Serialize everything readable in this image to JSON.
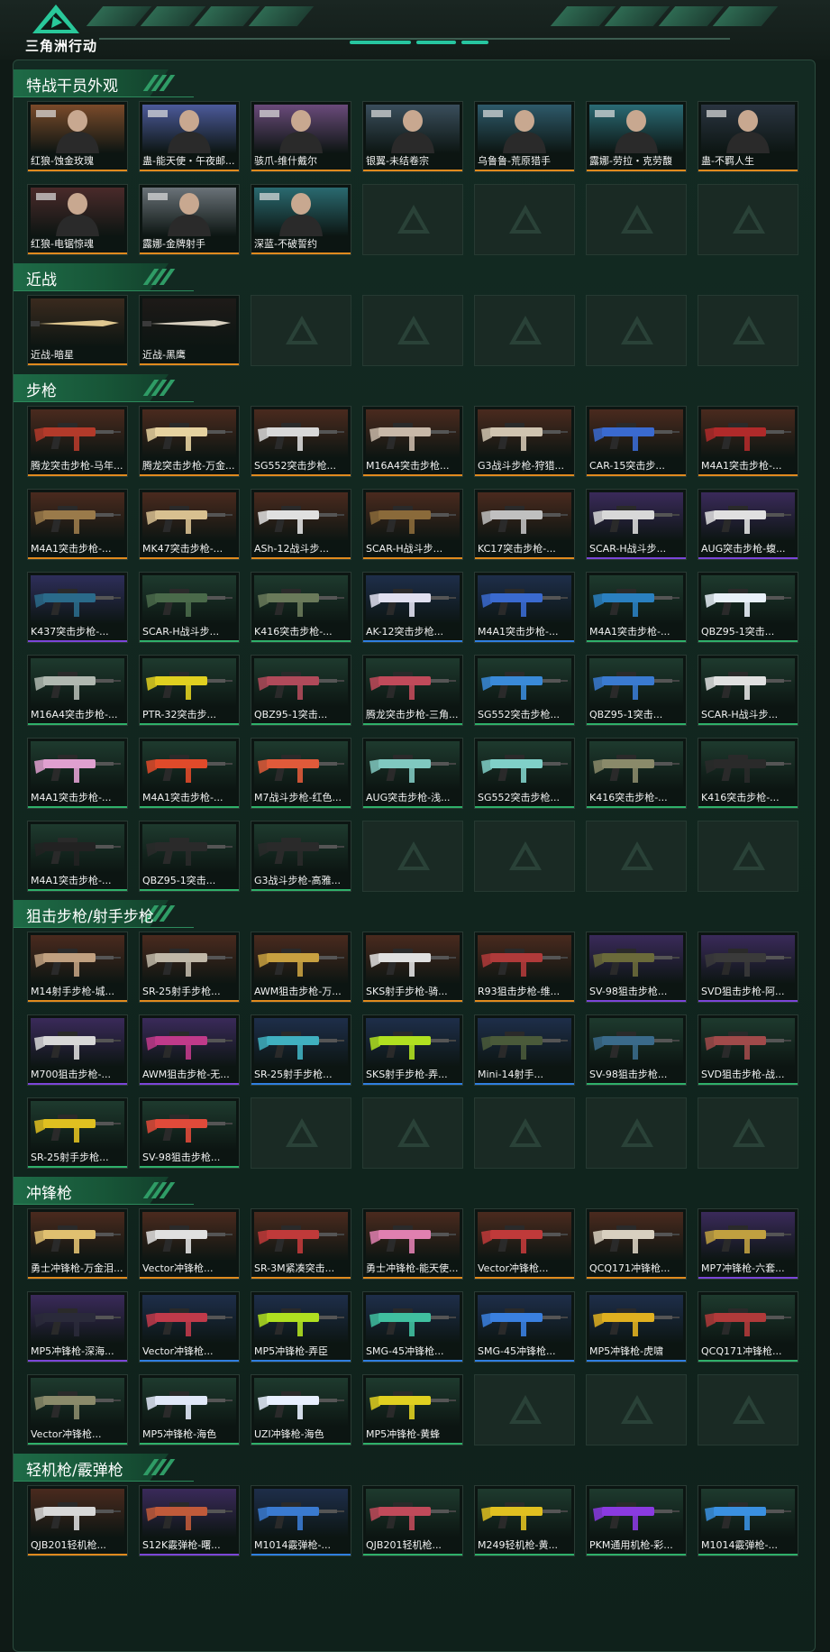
{
  "app": {
    "brand": "三角洲行动",
    "logo_icon": "delta-logo-icon"
  },
  "rarity_colors": {
    "gold": "#e08a1e",
    "purple": "#7b46d8",
    "blue": "#2f7fe0",
    "green": "#2fb06a"
  },
  "sections": [
    {
      "title": "特战干员外观",
      "rows": 2,
      "items": [
        {
          "label": "红狼-蚀金玫瑰",
          "rarity": "gold",
          "kind": "operator",
          "bg": "#7a4a2a"
        },
        {
          "label": "蛊-能天使・午夜邮...",
          "rarity": "gold",
          "kind": "operator",
          "bg": "#4c5a9a"
        },
        {
          "label": "骇爪-维什戴尔",
          "rarity": "gold",
          "kind": "operator",
          "bg": "#6a4a7a"
        },
        {
          "label": "银翼-未结卷宗",
          "rarity": "gold",
          "kind": "operator",
          "bg": "#3a4e5c"
        },
        {
          "label": "乌鲁鲁-荒原猎手",
          "rarity": "gold",
          "kind": "operator",
          "bg": "#2e5a6a"
        },
        {
          "label": "露娜-劳拉・克劳馥",
          "rarity": "gold",
          "kind": "operator",
          "bg": "#2a6a74"
        },
        {
          "label": "蛊-不羁人生",
          "rarity": "gold",
          "kind": "operator",
          "bg": "#2a3440"
        },
        {
          "label": "红狼-电锯惊魂",
          "rarity": "gold",
          "kind": "operator",
          "bg": "#4a2a2a"
        },
        {
          "label": "露娜-金牌射手",
          "rarity": "gold",
          "kind": "operator",
          "bg": "#6a7278"
        },
        {
          "label": "深蓝-不破誓约",
          "rarity": "gold",
          "kind": "operator",
          "bg": "#2a6a70"
        }
      ]
    },
    {
      "title": "近战",
      "rows": 1,
      "items": [
        {
          "label": "近战-暗星",
          "rarity": "gold",
          "kind": "blade",
          "bg": "#3a2a1e",
          "tone": "#e0c890"
        },
        {
          "label": "近战-黑鹰",
          "rarity": "gold",
          "kind": "blade",
          "bg": "#1e1a18",
          "tone": "#d8d0c0"
        }
      ]
    },
    {
      "title": "步枪",
      "rows": 6,
      "items": [
        {
          "label": "腾龙突击步枪-马年...",
          "rarity": "gold",
          "kind": "gun",
          "bg": "#4a2a1e",
          "tone": "#b33a2a"
        },
        {
          "label": "腾龙突击步枪-万金...",
          "rarity": "gold",
          "kind": "gun",
          "bg": "#4a2a1e",
          "tone": "#e6d2a0"
        },
        {
          "label": "SG552突击步枪...",
          "rarity": "gold",
          "kind": "gun",
          "bg": "#4a2a1e",
          "tone": "#d8d8d8"
        },
        {
          "label": "M16A4突击步枪...",
          "rarity": "gold",
          "kind": "gun",
          "bg": "#4a2a1e",
          "tone": "#c8b8a8"
        },
        {
          "label": "G3战斗步枪-狩猎...",
          "rarity": "gold",
          "kind": "gun",
          "bg": "#4a2a1e",
          "tone": "#d0c4b0"
        },
        {
          "label": "CAR-15突击步...",
          "rarity": "gold",
          "kind": "gun",
          "bg": "#4a2a1e",
          "tone": "#3a6ad0"
        },
        {
          "label": "M4A1突击步枪-...",
          "rarity": "gold",
          "kind": "gun",
          "bg": "#4a2a1e",
          "tone": "#b02a2a"
        },
        {
          "label": "M4A1突击步枪-...",
          "rarity": "gold",
          "kind": "gun",
          "bg": "#4a2a1e",
          "tone": "#9a7a4a"
        },
        {
          "label": "MK47突击步枪-...",
          "rarity": "gold",
          "kind": "gun",
          "bg": "#4a2a1e",
          "tone": "#d8c090"
        },
        {
          "label": "ASh-12战斗步...",
          "rarity": "gold",
          "kind": "gun",
          "bg": "#4a2a1e",
          "tone": "#e0e0e0"
        },
        {
          "label": "SCAR-H战斗步...",
          "rarity": "gold",
          "kind": "gun",
          "bg": "#4a2a1e",
          "tone": "#8a6a3a"
        },
        {
          "label": "KC17突击步枪-...",
          "rarity": "gold",
          "kind": "gun",
          "bg": "#4a2a1e",
          "tone": "#c0c0c0"
        },
        {
          "label": "SCAR-H战斗步...",
          "rarity": "purple",
          "kind": "gun",
          "bg": "#3a2a5a",
          "tone": "#d8d8d8"
        },
        {
          "label": "AUG突击步枪-蝮...",
          "rarity": "purple",
          "kind": "gun",
          "bg": "#3a2a5a",
          "tone": "#e0e0e0"
        },
        {
          "label": "K437突击步枪-...",
          "rarity": "purple",
          "kind": "gun",
          "bg": "#2e2e5a",
          "tone": "#2a6a8a"
        },
        {
          "label": "SCAR-H战斗步...",
          "rarity": "green",
          "kind": "gun",
          "bg": "#1e3a2e",
          "tone": "#4a6a4a"
        },
        {
          "label": "K416突击步枪-...",
          "rarity": "green",
          "kind": "gun",
          "bg": "#1e3a2e",
          "tone": "#6a7a5a"
        },
        {
          "label": "AK-12突击步枪...",
          "rarity": "blue",
          "kind": "gun",
          "bg": "#1e2e4a",
          "tone": "#e0e0f0"
        },
        {
          "label": "M4A1突击步枪-...",
          "rarity": "blue",
          "kind": "gun",
          "bg": "#1e2e4a",
          "tone": "#3a6ad0"
        },
        {
          "label": "M4A1突击步枪-...",
          "rarity": "green",
          "kind": "gun",
          "bg": "#1e3a2e",
          "tone": "#2a80c0"
        },
        {
          "label": "QBZ95-1突击...",
          "rarity": "green",
          "kind": "gun",
          "bg": "#1e3a2e",
          "tone": "#e8f0f8"
        },
        {
          "label": "M16A4突击步枪-...",
          "rarity": "green",
          "kind": "gun",
          "bg": "#1e3a2e",
          "tone": "#b0b8b0"
        },
        {
          "label": "PTR-32突击步...",
          "rarity": "green",
          "kind": "gun",
          "bg": "#1e3a2e",
          "tone": "#e0d020"
        },
        {
          "label": "QBZ95-1突击...",
          "rarity": "green",
          "kind": "gun",
          "bg": "#1e3a2e",
          "tone": "#b04a5a"
        },
        {
          "label": "腾龙突击步枪-三角...",
          "rarity": "green",
          "kind": "gun",
          "bg": "#1e3a2e",
          "tone": "#c04a5a"
        },
        {
          "label": "SG552突击步枪...",
          "rarity": "green",
          "kind": "gun",
          "bg": "#1e3a2e",
          "tone": "#3a8ad8"
        },
        {
          "label": "QBZ95-1突击...",
          "rarity": "green",
          "kind": "gun",
          "bg": "#1e3a2e",
          "tone": "#3a7ad0"
        },
        {
          "label": "SCAR-H战斗步...",
          "rarity": "green",
          "kind": "gun",
          "bg": "#1e3a2e",
          "tone": "#e0e0e0"
        },
        {
          "label": "M4A1突击步枪-...",
          "rarity": "green",
          "kind": "gun",
          "bg": "#1e3a2e",
          "tone": "#e0a0d0"
        },
        {
          "label": "M4A1突击步枪-...",
          "rarity": "green",
          "kind": "gun",
          "bg": "#1e3a2e",
          "tone": "#e04a2a"
        },
        {
          "label": "M7战斗步枪-红色...",
          "rarity": "green",
          "kind": "gun",
          "bg": "#1e3a2e",
          "tone": "#e05a3a"
        },
        {
          "label": "AUG突击步枪-浅...",
          "rarity": "green",
          "kind": "gun",
          "bg": "#1e3a2e",
          "tone": "#80c8c0"
        },
        {
          "label": "SG552突击步枪...",
          "rarity": "green",
          "kind": "gun",
          "bg": "#1e3a2e",
          "tone": "#80d0c8"
        },
        {
          "label": "K416突击步枪-...",
          "rarity": "green",
          "kind": "gun",
          "bg": "#1e3a2e",
          "tone": "#8a8a6a"
        },
        {
          "label": "K416突击步枪-...",
          "rarity": "green",
          "kind": "gun",
          "bg": "#1e3a2e",
          "tone": "#2a2a2a"
        },
        {
          "label": "M4A1突击步枪-...",
          "rarity": "green",
          "kind": "gun",
          "bg": "#1e3a2e",
          "tone": "#222222"
        },
        {
          "label": "QBZ95-1突击...",
          "rarity": "green",
          "kind": "gun",
          "bg": "#1e3a2e",
          "tone": "#2a2a2a"
        },
        {
          "label": "G3战斗步枪-高雅...",
          "rarity": "green",
          "kind": "gun",
          "bg": "#1e3a2e",
          "tone": "#2a2a2a"
        }
      ]
    },
    {
      "title": "狙击步枪/射手步枪",
      "rows": 3,
      "items": [
        {
          "label": "M14射手步枪-城...",
          "rarity": "gold",
          "kind": "gun",
          "bg": "#4a2a1e",
          "tone": "#c0a080"
        },
        {
          "label": "SR-25射手步枪...",
          "rarity": "gold",
          "kind": "gun",
          "bg": "#4a2a1e",
          "tone": "#c0b8a8"
        },
        {
          "label": "AWM狙击步枪-万...",
          "rarity": "gold",
          "kind": "gun",
          "bg": "#4a2a1e",
          "tone": "#c8a040"
        },
        {
          "label": "SKS射手步枪-骑...",
          "rarity": "gold",
          "kind": "gun",
          "bg": "#4a2a1e",
          "tone": "#e0e0e0"
        },
        {
          "label": "R93狙击步枪-维...",
          "rarity": "gold",
          "kind": "gun",
          "bg": "#4a2a1e",
          "tone": "#b03a3a"
        },
        {
          "label": "SV-98狙击步枪...",
          "rarity": "purple",
          "kind": "gun",
          "bg": "#3a2a5a",
          "tone": "#6a6a3a"
        },
        {
          "label": "SVD狙击步枪-阿...",
          "rarity": "purple",
          "kind": "gun",
          "bg": "#3a2a5a",
          "tone": "#3a3a3a"
        },
        {
          "label": "M700狙击步枪-...",
          "rarity": "purple",
          "kind": "gun",
          "bg": "#3a2a5a",
          "tone": "#d8d8d8"
        },
        {
          "label": "AWM狙击步枪-无...",
          "rarity": "purple",
          "kind": "gun",
          "bg": "#3a2a5a",
          "tone": "#c03a8a"
        },
        {
          "label": "SR-25射手步枪...",
          "rarity": "blue",
          "kind": "gun",
          "bg": "#1e2e4a",
          "tone": "#40b0c0"
        },
        {
          "label": "SKS射手步枪-弄...",
          "rarity": "blue",
          "kind": "gun",
          "bg": "#1e2e4a",
          "tone": "#b0e020"
        },
        {
          "label": "Mini-14射手...",
          "rarity": "blue",
          "kind": "gun",
          "bg": "#1e2e4a",
          "tone": "#4a5a3a"
        },
        {
          "label": "SV-98狙击步枪...",
          "rarity": "green",
          "kind": "gun",
          "bg": "#1e3a2e",
          "tone": "#3a6a8a"
        },
        {
          "label": "SVD狙击步枪-战...",
          "rarity": "green",
          "kind": "gun",
          "bg": "#1e3a2e",
          "tone": "#a04a4a"
        },
        {
          "label": "SR-25射手步枪...",
          "rarity": "green",
          "kind": "gun",
          "bg": "#1e3a2e",
          "tone": "#e0c020"
        },
        {
          "label": "SV-98狙击步枪...",
          "rarity": "green",
          "kind": "gun",
          "bg": "#1e3a2e",
          "tone": "#e04a3a"
        }
      ]
    },
    {
      "title": "冲锋枪",
      "rows": 3,
      "items": [
        {
          "label": "勇士冲锋枪-万金泪...",
          "rarity": "gold",
          "kind": "gun",
          "bg": "#4a2a1e",
          "tone": "#e0c070"
        },
        {
          "label": "Vector冲锋枪...",
          "rarity": "gold",
          "kind": "gun",
          "bg": "#4a2a1e",
          "tone": "#e0e0e0"
        },
        {
          "label": "SR-3M紧凑突击...",
          "rarity": "gold",
          "kind": "gun",
          "bg": "#4a2a1e",
          "tone": "#c03a3a"
        },
        {
          "label": "勇士冲锋枪-能天使...",
          "rarity": "gold",
          "kind": "gun",
          "bg": "#4a2a1e",
          "tone": "#e080b0"
        },
        {
          "label": "Vector冲锋枪...",
          "rarity": "gold",
          "kind": "gun",
          "bg": "#4a2a1e",
          "tone": "#c03a3a"
        },
        {
          "label": "QCQ171冲锋枪...",
          "rarity": "gold",
          "kind": "gun",
          "bg": "#4a2a1e",
          "tone": "#d8d0c0"
        },
        {
          "label": "MP7冲锋枪-六套...",
          "rarity": "purple",
          "kind": "gun",
          "bg": "#3a2a5a",
          "tone": "#c0a040"
        },
        {
          "label": "MP5冲锋枪-深海...",
          "rarity": "purple",
          "kind": "gun",
          "bg": "#3a2a5a",
          "tone": "#2a2a3a"
        },
        {
          "label": "Vector冲锋枪...",
          "rarity": "blue",
          "kind": "gun",
          "bg": "#1e2e4a",
          "tone": "#c03a4a"
        },
        {
          "label": "MP5冲锋枪-弄臣",
          "rarity": "blue",
          "kind": "gun",
          "bg": "#1e2e4a",
          "tone": "#b0e020"
        },
        {
          "label": "SMG-45冲锋枪...",
          "rarity": "blue",
          "kind": "gun",
          "bg": "#1e2e4a",
          "tone": "#40c0a0"
        },
        {
          "label": "SMG-45冲锋枪...",
          "rarity": "blue",
          "kind": "gun",
          "bg": "#1e2e4a",
          "tone": "#3a80e0"
        },
        {
          "label": "MP5冲锋枪-虎啸",
          "rarity": "blue",
          "kind": "gun",
          "bg": "#1e2e4a",
          "tone": "#e0b020"
        },
        {
          "label": "QCQ171冲锋枪...",
          "rarity": "green",
          "kind": "gun",
          "bg": "#1e3a2e",
          "tone": "#b03a3a"
        },
        {
          "label": "Vector冲锋枪...",
          "rarity": "green",
          "kind": "gun",
          "bg": "#1e3a2e",
          "tone": "#8a8a6a"
        },
        {
          "label": "MP5冲锋枪-海色",
          "rarity": "green",
          "kind": "gun",
          "bg": "#1e3a2e",
          "tone": "#e0e8f8"
        },
        {
          "label": "UZI冲锋枪-海色",
          "rarity": "green",
          "kind": "gun",
          "bg": "#1e3a2e",
          "tone": "#e8f0ff"
        },
        {
          "label": "MP5冲锋枪-黄蜂",
          "rarity": "green",
          "kind": "gun",
          "bg": "#1e3a2e",
          "tone": "#e0d020"
        }
      ]
    },
    {
      "title": "轻机枪/霰弹枪",
      "rows": 1,
      "items": [
        {
          "label": "QJB201轻机枪...",
          "rarity": "gold",
          "kind": "gun",
          "bg": "#4a2a1e",
          "tone": "#d8d8d8"
        },
        {
          "label": "S12K霰弹枪-曙...",
          "rarity": "purple",
          "kind": "gun",
          "bg": "#3a2a5a",
          "tone": "#c05a3a"
        },
        {
          "label": "M1014霰弹枪-...",
          "rarity": "blue",
          "kind": "gun",
          "bg": "#1e2e4a",
          "tone": "#3a7ad0"
        },
        {
          "label": "QJB201轻机枪...",
          "rarity": "green",
          "kind": "gun",
          "bg": "#1e3a2e",
          "tone": "#c04a5a"
        },
        {
          "label": "M249轻机枪-黄...",
          "rarity": "green",
          "kind": "gun",
          "bg": "#1e3a2e",
          "tone": "#e0c020"
        },
        {
          "label": "PKM通用机枪-彩...",
          "rarity": "green",
          "kind": "gun",
          "bg": "#1e3a2e",
          "tone": "#8a3ae0"
        },
        {
          "label": "M1014霰弹枪-...",
          "rarity": "green",
          "kind": "gun",
          "bg": "#1e3a2e",
          "tone": "#3a90e0"
        }
      ]
    }
  ]
}
